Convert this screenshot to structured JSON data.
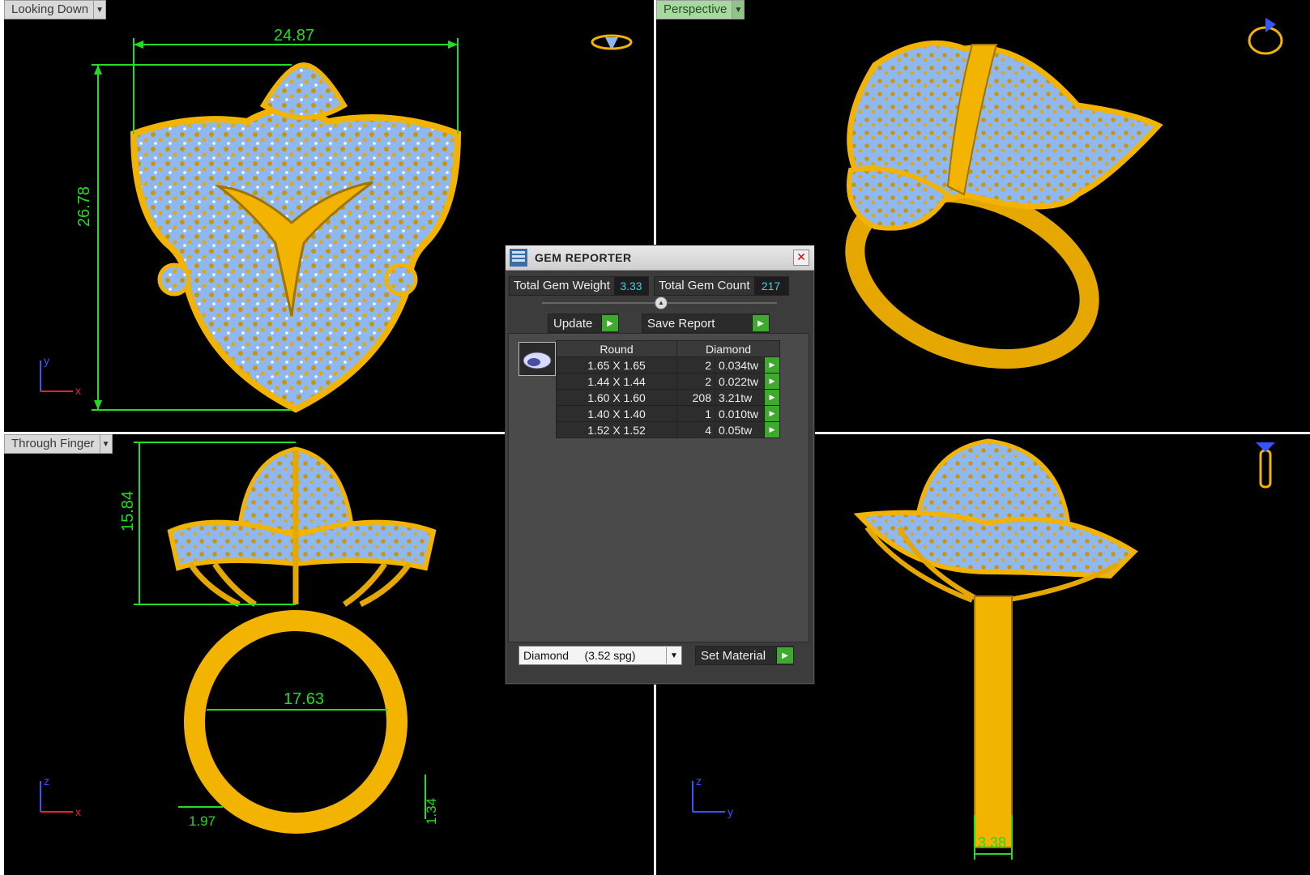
{
  "viewports": {
    "top_left": {
      "label": "Looking Down",
      "dims": [
        "24.87",
        "26.78"
      ],
      "axes": [
        "y",
        "x"
      ]
    },
    "top_right": {
      "label": "Perspective"
    },
    "bottom_left": {
      "label": "Through Finger",
      "dims": [
        "15.84",
        "17.63",
        "1.97",
        "1.34"
      ],
      "axes": [
        "z",
        "x"
      ]
    },
    "bottom_right": {
      "dims": [
        "3.38"
      ],
      "axes": [
        "z",
        "y"
      ]
    }
  },
  "gem_reporter": {
    "title": "GEM REPORTER",
    "total_weight_label": "Total Gem Weight",
    "total_weight_value": "3.33",
    "total_count_label": "Total Gem Count",
    "total_count_value": "217",
    "update_label": "Update",
    "save_label": "Save Report",
    "shape_header": "Round",
    "material_header": "Diamond",
    "rows": [
      {
        "size": "1.65 X 1.65",
        "count": "2",
        "weight": "0.034tw"
      },
      {
        "size": "1.44 X 1.44",
        "count": "2",
        "weight": "0.022tw"
      },
      {
        "size": "1.60 X 1.60",
        "count": "208",
        "weight": "3.21tw"
      },
      {
        "size": "1.40 X 1.40",
        "count": "1",
        "weight": "0.010tw"
      },
      {
        "size": "1.52 X 1.52",
        "count": "4",
        "weight": "0.05tw"
      }
    ],
    "material_select": "Diamond     (3.52 spg)",
    "set_material_label": "Set Material"
  },
  "colors": {
    "gold": "#f2b400",
    "stone": "#8fb8f0",
    "dim": "#22dd22",
    "accent": "#3daa2e"
  },
  "icons": [
    "dropdown-arrow-icon",
    "ring-preview-icon",
    "gem-reporter-icon",
    "close-icon",
    "play-arrow-icon",
    "gem-thumbnail-icon"
  ]
}
